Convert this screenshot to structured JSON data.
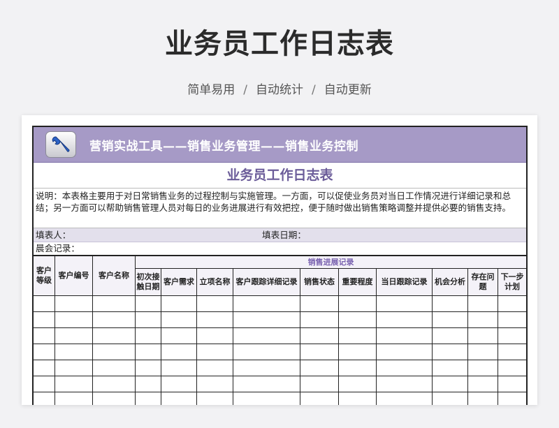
{
  "hero": {
    "title": "业务员工作日志表",
    "tags": [
      "简单易用",
      "自动统计",
      "自动更新"
    ],
    "separator": "/"
  },
  "banner": {
    "icon": "wrench-icon",
    "text": "营销实战工具——销售业务管理——销售业务控制"
  },
  "sheet": {
    "title": "业务员工作日志表",
    "description": "说明：本表格主要用于对日常销售业务的过程控制与实施管理。一方面，可以促使业务员对当日工作情况进行详细记录和总结；另一方面可以帮助销售管理人员对每日的业务进展进行有效把控，便于随时做出销售策略调整并提供必要的销售支持。",
    "filler_label": "填表人：",
    "date_label": "填表日期：",
    "meeting_label": "晨会记录："
  },
  "table": {
    "group_header": "销售进展记录",
    "fixed_headers": [
      "客户等级",
      "客户编号",
      "客户名称"
    ],
    "progress_headers": [
      "初次接触日期",
      "客户需求",
      "立项名称",
      "客户跟踪详细记录",
      "销售状态",
      "重要程度",
      "当日跟踪记录",
      "机会分析",
      "存在问题",
      "下一步计划"
    ],
    "empty_rows": 7
  },
  "colors": {
    "banner_bg": "#a69ac6",
    "title_purple": "#6b5c99",
    "fill_row_bg": "#e3e0ec"
  }
}
